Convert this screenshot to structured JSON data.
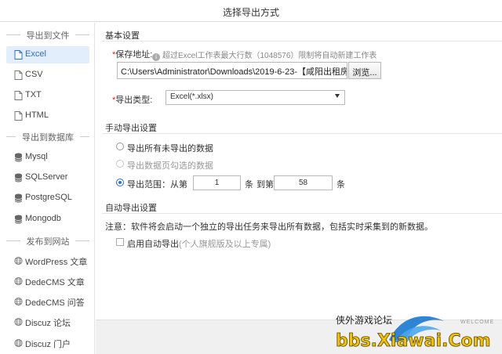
{
  "window": {
    "title": "选择导出方式"
  },
  "sidebar": {
    "sections": [
      {
        "label": "导出到文件"
      },
      {
        "label": "导出到数据库"
      },
      {
        "label": "发布到网站"
      }
    ],
    "items": [
      {
        "label": "Excel",
        "icon": "file-icon",
        "active": true
      },
      {
        "label": "CSV",
        "icon": "file-icon"
      },
      {
        "label": "TXT",
        "icon": "file-icon"
      },
      {
        "label": "HTML",
        "icon": "file-icon"
      },
      {
        "label": "Mysql",
        "icon": "database-icon"
      },
      {
        "label": "SQLServer",
        "icon": "database-icon"
      },
      {
        "label": "PostgreSQL",
        "icon": "database-icon"
      },
      {
        "label": "Mongodb",
        "icon": "database-icon"
      },
      {
        "label": "WordPress 文章",
        "icon": "globe-icon"
      },
      {
        "label": "DedeCMS 文章",
        "icon": "globe-icon"
      },
      {
        "label": "DedeCMS 问答",
        "icon": "globe-icon"
      },
      {
        "label": "Discuz 论坛",
        "icon": "globe-icon"
      },
      {
        "label": "Discuz 门户",
        "icon": "globe-icon"
      }
    ]
  },
  "basic": {
    "title": "基本设置",
    "save_label": "保存地址:",
    "save_hint": "超过Excel工作表最大行数（1048576）限制将自动新建工作表",
    "path_value": "C:\\Users\\Administrator\\Downloads\\2019-6-23-【咸阳出租房",
    "browse_label": "浏览...",
    "type_label": "导出类型:",
    "type_value": "Excel(*.xlsx)"
  },
  "manual": {
    "title": "手动导出设置",
    "opt_all": "导出所有未导出的数据",
    "opt_selected": "导出数据页勾选的数据",
    "opt_range": "导出范围：从第",
    "range_from": "1",
    "unit_from": "条",
    "to_label": "到第",
    "range_to": "58",
    "unit_to": "条"
  },
  "auto": {
    "title": "自动导出设置",
    "note": "注意：软件将会启动一个独立的导出任务来导出所有数据，包括实时采集到的新数据。",
    "enable_label": "启用自动导出",
    "enable_hint": "(个人旗舰版及以上专属)"
  },
  "watermark": {
    "cn": "侠外游戏论坛",
    "welcome": "WELCOME",
    "url": "bbs.Xiawai.Com"
  },
  "colors": {
    "accent": "#2a6fd6",
    "active_bg": "#e3eefc",
    "required": "#e02020",
    "watermark_yellow": "#f2c400"
  }
}
